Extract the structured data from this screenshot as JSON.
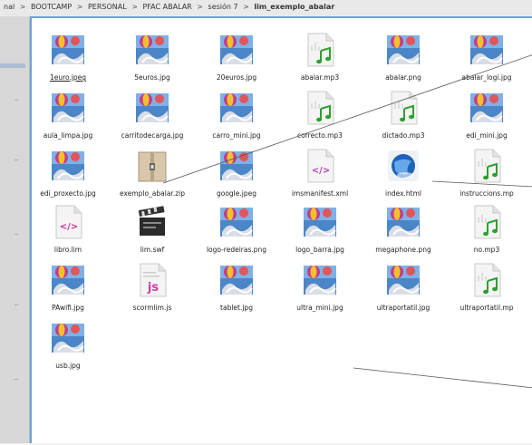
{
  "breadcrumb": {
    "prefix": "nal",
    "parts": [
      "BOOTCAMP",
      "PERSONAL",
      "PFAC ABALAR",
      "sesión 7"
    ],
    "current": "lim_exemplo_abalar",
    "separator": ">"
  },
  "files": [
    {
      "name": "1euro.jpeg",
      "type": "image"
    },
    {
      "name": "5euros.jpg",
      "type": "image"
    },
    {
      "name": "20euros.jpg",
      "type": "image"
    },
    {
      "name": "abalar.mp3",
      "type": "audio"
    },
    {
      "name": "abalar.png",
      "type": "image"
    },
    {
      "name": "abalar_logi.jpg",
      "type": "image"
    },
    {
      "name": "aula_limpa.jpg",
      "type": "image"
    },
    {
      "name": "carritodecarga.jpg",
      "type": "image"
    },
    {
      "name": "carro_mini.jpg",
      "type": "image"
    },
    {
      "name": "correcto.mp3",
      "type": "audio"
    },
    {
      "name": "dictado.mp3",
      "type": "audio"
    },
    {
      "name": "edi_mini.jpg",
      "type": "image"
    },
    {
      "name": "edi_proxecto.jpg",
      "type": "image"
    },
    {
      "name": "exemplo_abalar.zip",
      "type": "archive"
    },
    {
      "name": "google.jpeg",
      "type": "image"
    },
    {
      "name": "imsmanifest.xml",
      "type": "xml"
    },
    {
      "name": "index.html",
      "type": "html"
    },
    {
      "name": "instruccions.mp",
      "type": "audio"
    },
    {
      "name": "libro.lim",
      "type": "code"
    },
    {
      "name": "lim.swf",
      "type": "video"
    },
    {
      "name": "logo-redeiras.png",
      "type": "image"
    },
    {
      "name": "logo_barra.jpg",
      "type": "image"
    },
    {
      "name": "megaphone.png",
      "type": "image"
    },
    {
      "name": "no.mp3",
      "type": "audio"
    },
    {
      "name": "PAwifi.jpg",
      "type": "image"
    },
    {
      "name": "scormlim.js",
      "type": "script"
    },
    {
      "name": "tablet.jpg",
      "type": "image"
    },
    {
      "name": "ultra_mini.jpg",
      "type": "image"
    },
    {
      "name": "ultraportatil.jpg",
      "type": "image"
    },
    {
      "name": "ultraportatil.mp",
      "type": "audio"
    },
    {
      "name": "usb.jpg",
      "type": "image"
    }
  ],
  "colors": {
    "selection_border": "#6f9fd8",
    "annotation_line": "#555555"
  }
}
